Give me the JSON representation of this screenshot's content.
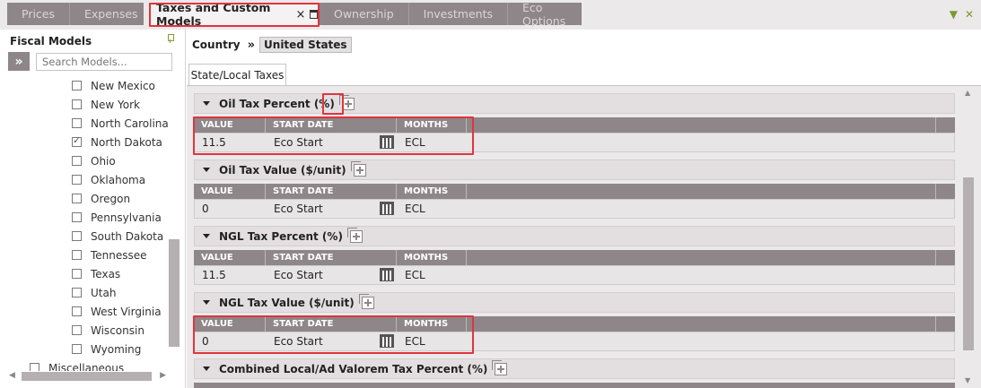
{
  "tabs": {
    "left": [
      {
        "label": "Prices"
      },
      {
        "label": "Expenses"
      }
    ],
    "active": {
      "label": "Taxes and Custom Models",
      "close_glyph": "×"
    },
    "right": [
      {
        "label": "Ownership"
      },
      {
        "label": "Investments"
      },
      {
        "label": "Eco Options"
      }
    ],
    "strip_icons": {
      "dropdown_glyph": "▼",
      "close_glyph": "✕"
    }
  },
  "left_panel": {
    "title": "Fiscal Models",
    "expand_glyph": "»",
    "search_placeholder": "Search Models...",
    "states": [
      {
        "label": "New Mexico",
        "checked": false
      },
      {
        "label": "New York",
        "checked": false
      },
      {
        "label": "North Carolina",
        "checked": false
      },
      {
        "label": "North Dakota",
        "checked": true
      },
      {
        "label": "Ohio",
        "checked": false
      },
      {
        "label": "Oklahoma",
        "checked": false
      },
      {
        "label": "Oregon",
        "checked": false
      },
      {
        "label": "Pennsylvania",
        "checked": false
      },
      {
        "label": "South Dakota",
        "checked": false
      },
      {
        "label": "Tennessee",
        "checked": false
      },
      {
        "label": "Texas",
        "checked": false
      },
      {
        "label": "Utah",
        "checked": false
      },
      {
        "label": "West Virginia",
        "checked": false
      },
      {
        "label": "Wisconsin",
        "checked": false
      },
      {
        "label": "Wyoming",
        "checked": false
      }
    ],
    "misc_label": "Miscellaneous"
  },
  "breadcrumb": {
    "country_label": "Country",
    "separator": "»",
    "selected": "United States"
  },
  "subtab": {
    "label": "State/Local Taxes"
  },
  "grid_columns": {
    "value": "VALUE",
    "start": "START DATE",
    "months": "MONTHS"
  },
  "sections": [
    {
      "title": "Oil Tax Percent (%)",
      "row": {
        "value": "11.5",
        "start": "Eco Start",
        "months": "ECL"
      }
    },
    {
      "title": "Oil Tax Value ($/unit)",
      "row": {
        "value": "0",
        "start": "Eco Start",
        "months": "ECL"
      }
    },
    {
      "title": "NGL Tax Percent (%)",
      "row": {
        "value": "11.5",
        "start": "Eco Start",
        "months": "ECL"
      }
    },
    {
      "title": "NGL Tax Value ($/unit)",
      "row": {
        "value": "0",
        "start": "Eco Start",
        "months": "ECL"
      }
    },
    {
      "title": "Combined Local/Ad Valorem Tax Percent (%)"
    }
  ],
  "scroll_glyphs": {
    "up": "▲",
    "down": "▼",
    "left": "◀",
    "right": "▶"
  },
  "colors": {
    "header_gray": "#8e8688",
    "highlight_red": "#e0343c",
    "accent_green": "#7b9a2a"
  }
}
